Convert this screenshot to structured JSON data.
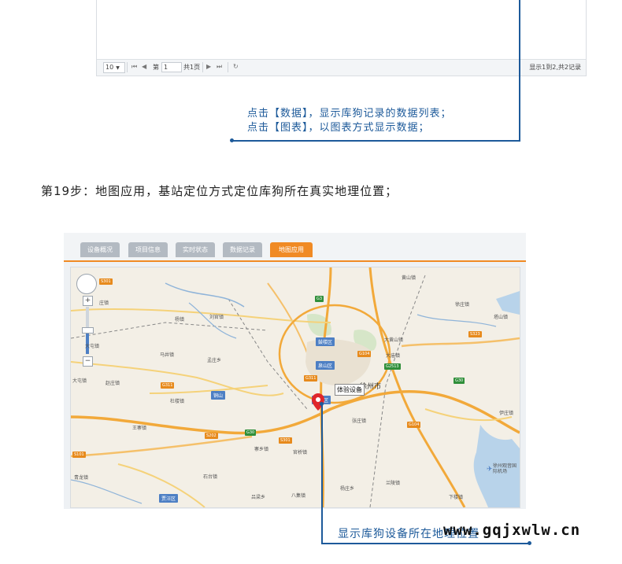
{
  "pager": {
    "page_size": "10",
    "page_prefix": "第",
    "page_value": "1",
    "page_total": "共1页",
    "info": "显示1到2,共2记录"
  },
  "callout1": {
    "line1": "点击【数据】，显示库狗记录的数据列表；",
    "line2": "点击【图表】，以图表方式显示数据；"
  },
  "step": {
    "text": "第19步：地图应用，基站定位方式定位库狗所在真实地理位置；"
  },
  "tabs": [
    "设备概况",
    "项目信息",
    "实时状态",
    "数据记录",
    "地图应用"
  ],
  "active_tab": 4,
  "map": {
    "labels": {
      "huangshan": "黄山镇",
      "zhuangzhen": "庄镇",
      "yangzhen": "杨镇",
      "liuguan": "刘官镇",
      "mabeizhen": "马井镇",
      "mengzhuang": "孟庄乡",
      "dajing": "大屯镇",
      "zhaozhuang": "赵庄镇",
      "doulou": "杜楼镇",
      "wangzhai": "王寨镇",
      "zhaishizhen": "寨乡镇",
      "qingzhen": "青龙镇",
      "shitai": "石台镇",
      "lishi": "吕梁乡",
      "dahuang": "大黄山镇",
      "dahu": "大庙镇",
      "zhanggu": "张庄镇",
      "guanlu": "官桥镇",
      "yangzhuang": "杨庄乡",
      "xuzhuang": "徐庄镇",
      "yizhuang": "伊庄镇",
      "xialou": "下楼镇",
      "tashan": "塔山镇",
      "bacheng": "八集镇",
      "lanling": "兰陵镇",
      "xuzhou_airport": "徐州观音国际机场"
    },
    "city": "徐州市",
    "districts": {
      "gulou": "鼓楼区",
      "quanshan": "泉山区",
      "tongshan": "铜山区",
      "jiawang": "贾汪区",
      "puzhou": "铜山"
    },
    "roads": {
      "s301": "S301",
      "s101": "S101",
      "g3": "G3",
      "g104": "G104",
      "g2513": "G2513",
      "g30": "G30",
      "g311": "G311",
      "s202": "S202",
      "s323": "S323",
      "s301b": "S301",
      "g104b": "G104",
      "g30b": "G30"
    },
    "device_popup": "体验设备",
    "marker_color": "#e0262b"
  },
  "callout2": {
    "text": "显示库狗设备所在地理位置"
  },
  "watermark": "www.gqjxwlw.cn",
  "colors": {
    "accent": "#f08a24",
    "callout_blue": "#1d5a9a",
    "tab_inactive": "#b3bac2"
  }
}
